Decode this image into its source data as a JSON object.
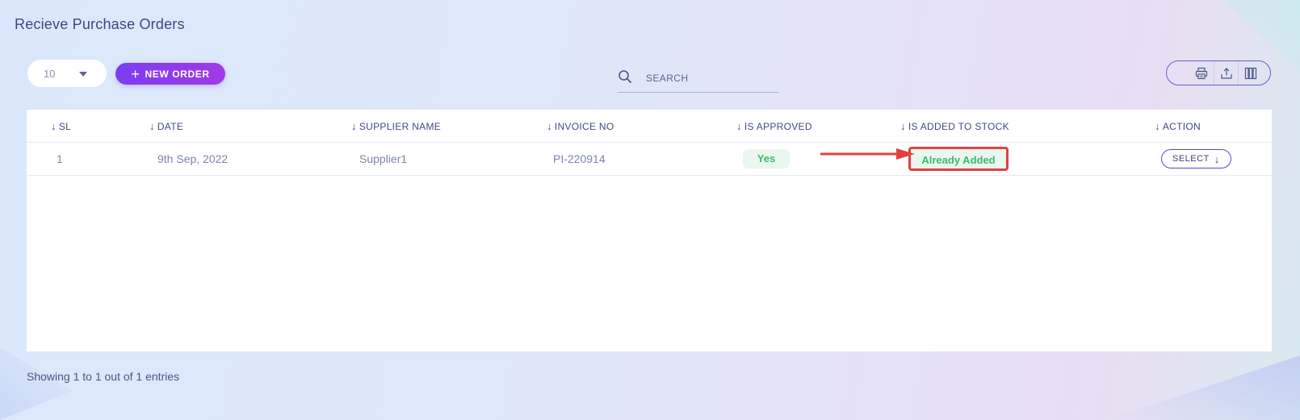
{
  "page": {
    "title": "Recieve Purchase Orders"
  },
  "toolbar": {
    "page_size": "10",
    "new_order_label": "NEW ORDER",
    "search_placeholder": "SEARCH",
    "tools": [
      "print-icon",
      "export-icon",
      "columns-icon"
    ]
  },
  "table": {
    "columns": [
      "SL",
      "DATE",
      "SUPPLIER NAME",
      "INVOICE NO",
      "IS APPROVED",
      "IS ADDED TO STOCK",
      "ACTION"
    ],
    "rows": [
      {
        "sl": "1",
        "date": "9th Sep, 2022",
        "supplier": "Supplier1",
        "invoice": "PI-220914",
        "approved": "Yes",
        "stock": "Already Added",
        "action": "SELECT"
      }
    ]
  },
  "footer": {
    "entries": "Showing 1 to 1 out of 1 entries"
  },
  "colors": {
    "accent": "#7b3df0",
    "success": "#3cba6a",
    "highlight": "#e24040"
  }
}
